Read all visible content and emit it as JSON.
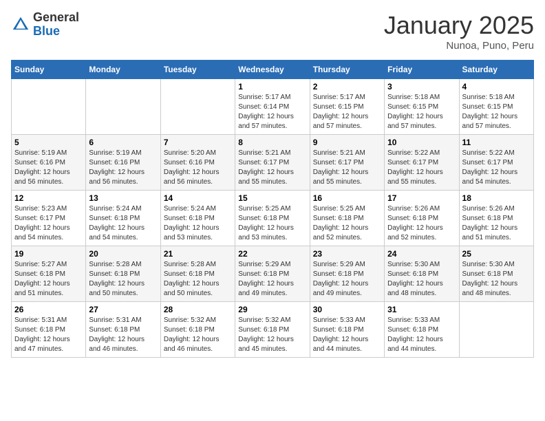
{
  "header": {
    "logo_general": "General",
    "logo_blue": "Blue",
    "title": "January 2025",
    "subtitle": "Nunoa, Puno, Peru"
  },
  "weekdays": [
    "Sunday",
    "Monday",
    "Tuesday",
    "Wednesday",
    "Thursday",
    "Friday",
    "Saturday"
  ],
  "weeks": [
    [
      {
        "day": "",
        "info": ""
      },
      {
        "day": "",
        "info": ""
      },
      {
        "day": "",
        "info": ""
      },
      {
        "day": "1",
        "info": "Sunrise: 5:17 AM\nSunset: 6:14 PM\nDaylight: 12 hours\nand 57 minutes."
      },
      {
        "day": "2",
        "info": "Sunrise: 5:17 AM\nSunset: 6:15 PM\nDaylight: 12 hours\nand 57 minutes."
      },
      {
        "day": "3",
        "info": "Sunrise: 5:18 AM\nSunset: 6:15 PM\nDaylight: 12 hours\nand 57 minutes."
      },
      {
        "day": "4",
        "info": "Sunrise: 5:18 AM\nSunset: 6:15 PM\nDaylight: 12 hours\nand 57 minutes."
      }
    ],
    [
      {
        "day": "5",
        "info": "Sunrise: 5:19 AM\nSunset: 6:16 PM\nDaylight: 12 hours\nand 56 minutes."
      },
      {
        "day": "6",
        "info": "Sunrise: 5:19 AM\nSunset: 6:16 PM\nDaylight: 12 hours\nand 56 minutes."
      },
      {
        "day": "7",
        "info": "Sunrise: 5:20 AM\nSunset: 6:16 PM\nDaylight: 12 hours\nand 56 minutes."
      },
      {
        "day": "8",
        "info": "Sunrise: 5:21 AM\nSunset: 6:17 PM\nDaylight: 12 hours\nand 55 minutes."
      },
      {
        "day": "9",
        "info": "Sunrise: 5:21 AM\nSunset: 6:17 PM\nDaylight: 12 hours\nand 55 minutes."
      },
      {
        "day": "10",
        "info": "Sunrise: 5:22 AM\nSunset: 6:17 PM\nDaylight: 12 hours\nand 55 minutes."
      },
      {
        "day": "11",
        "info": "Sunrise: 5:22 AM\nSunset: 6:17 PM\nDaylight: 12 hours\nand 54 minutes."
      }
    ],
    [
      {
        "day": "12",
        "info": "Sunrise: 5:23 AM\nSunset: 6:17 PM\nDaylight: 12 hours\nand 54 minutes."
      },
      {
        "day": "13",
        "info": "Sunrise: 5:24 AM\nSunset: 6:18 PM\nDaylight: 12 hours\nand 54 minutes."
      },
      {
        "day": "14",
        "info": "Sunrise: 5:24 AM\nSunset: 6:18 PM\nDaylight: 12 hours\nand 53 minutes."
      },
      {
        "day": "15",
        "info": "Sunrise: 5:25 AM\nSunset: 6:18 PM\nDaylight: 12 hours\nand 53 minutes."
      },
      {
        "day": "16",
        "info": "Sunrise: 5:25 AM\nSunset: 6:18 PM\nDaylight: 12 hours\nand 52 minutes."
      },
      {
        "day": "17",
        "info": "Sunrise: 5:26 AM\nSunset: 6:18 PM\nDaylight: 12 hours\nand 52 minutes."
      },
      {
        "day": "18",
        "info": "Sunrise: 5:26 AM\nSunset: 6:18 PM\nDaylight: 12 hours\nand 51 minutes."
      }
    ],
    [
      {
        "day": "19",
        "info": "Sunrise: 5:27 AM\nSunset: 6:18 PM\nDaylight: 12 hours\nand 51 minutes."
      },
      {
        "day": "20",
        "info": "Sunrise: 5:28 AM\nSunset: 6:18 PM\nDaylight: 12 hours\nand 50 minutes."
      },
      {
        "day": "21",
        "info": "Sunrise: 5:28 AM\nSunset: 6:18 PM\nDaylight: 12 hours\nand 50 minutes."
      },
      {
        "day": "22",
        "info": "Sunrise: 5:29 AM\nSunset: 6:18 PM\nDaylight: 12 hours\nand 49 minutes."
      },
      {
        "day": "23",
        "info": "Sunrise: 5:29 AM\nSunset: 6:18 PM\nDaylight: 12 hours\nand 49 minutes."
      },
      {
        "day": "24",
        "info": "Sunrise: 5:30 AM\nSunset: 6:18 PM\nDaylight: 12 hours\nand 48 minutes."
      },
      {
        "day": "25",
        "info": "Sunrise: 5:30 AM\nSunset: 6:18 PM\nDaylight: 12 hours\nand 48 minutes."
      }
    ],
    [
      {
        "day": "26",
        "info": "Sunrise: 5:31 AM\nSunset: 6:18 PM\nDaylight: 12 hours\nand 47 minutes."
      },
      {
        "day": "27",
        "info": "Sunrise: 5:31 AM\nSunset: 6:18 PM\nDaylight: 12 hours\nand 46 minutes."
      },
      {
        "day": "28",
        "info": "Sunrise: 5:32 AM\nSunset: 6:18 PM\nDaylight: 12 hours\nand 46 minutes."
      },
      {
        "day": "29",
        "info": "Sunrise: 5:32 AM\nSunset: 6:18 PM\nDaylight: 12 hours\nand 45 minutes."
      },
      {
        "day": "30",
        "info": "Sunrise: 5:33 AM\nSunset: 6:18 PM\nDaylight: 12 hours\nand 44 minutes."
      },
      {
        "day": "31",
        "info": "Sunrise: 5:33 AM\nSunset: 6:18 PM\nDaylight: 12 hours\nand 44 minutes."
      },
      {
        "day": "",
        "info": ""
      }
    ]
  ]
}
